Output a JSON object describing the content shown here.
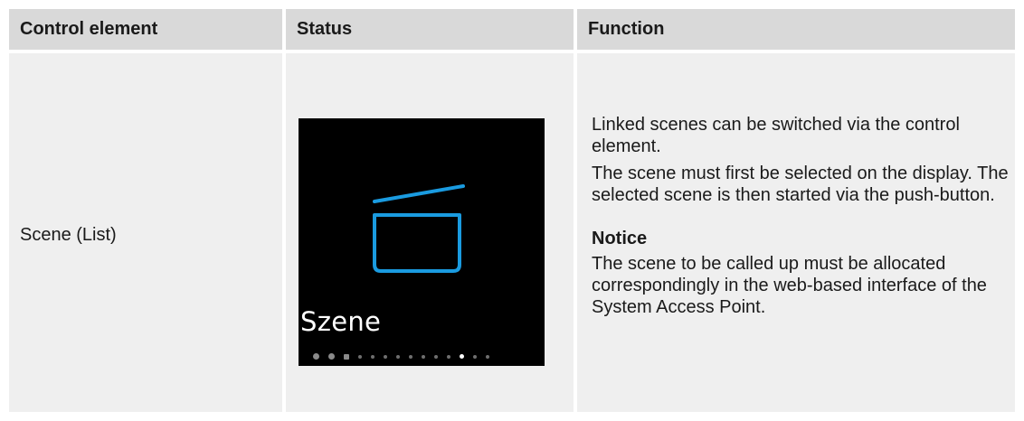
{
  "headers": {
    "control": "Control element",
    "status": "Status",
    "function": "Function"
  },
  "row": {
    "control_label": "Scene (List)",
    "display": {
      "title": "Szene",
      "icon": "scene-clapperboard-icon",
      "accent": "#1a9be0",
      "page_count": 14,
      "active_page": 11
    },
    "function_p1": "Linked scenes can be switched via the control element.",
    "function_p2": "The scene must first be selected on the display. The selected scene is then started via the push-button.",
    "notice_title": "Notice",
    "notice_text": "The scene to be called up must be allocated correspondingly in the web-based interface of the System Access Point."
  }
}
